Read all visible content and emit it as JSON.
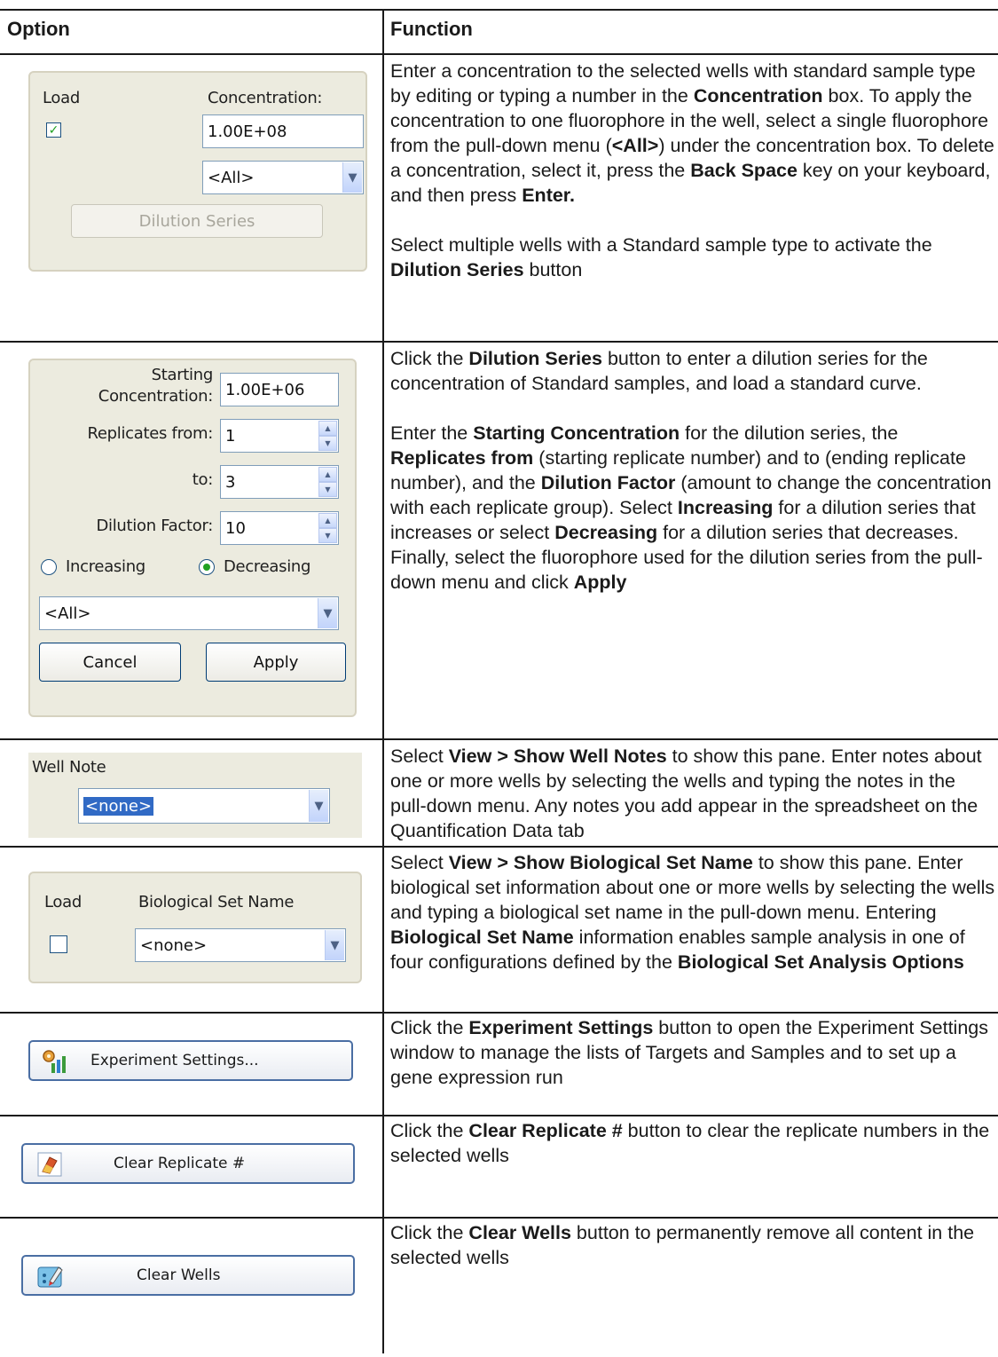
{
  "header": {
    "option": "Option",
    "function": "Function"
  },
  "widgets": {
    "concentration": {
      "load_label": "Load",
      "concentration_label": "Concentration:",
      "concentration_value": "1.00E+08",
      "fluor_select": "<All>",
      "dilution_button": "Dilution Series",
      "load_checked": true
    },
    "dilution": {
      "starting_label_1": "Starting",
      "starting_label_2": "Concentration:",
      "starting_value": "1.00E+06",
      "replicates_from_label": "Replicates from:",
      "replicates_from_value": "1",
      "to_label": "to:",
      "to_value": "3",
      "factor_label": "Dilution Factor:",
      "factor_value": "10",
      "increasing_label": "Increasing",
      "decreasing_label": "Decreasing",
      "fluor_select": "<All>",
      "cancel_button": "Cancel",
      "apply_button": "Apply"
    },
    "well_note": {
      "label": "Well Note",
      "value": "<none>"
    },
    "bio_set": {
      "load_label": "Load",
      "name_label": "Biological Set Name",
      "value": "<none>"
    },
    "experiment_settings": {
      "label": "Experiment Settings..."
    },
    "clear_replicate": {
      "label": "Clear Replicate #"
    },
    "clear_wells": {
      "label": "Clear Wells"
    }
  },
  "functions": {
    "r1_a": [
      "Enter a concentration to the selected wells with standard sample type by editing or typing a number in the ",
      "Concentration",
      " box. To apply the concentration to one fluorophore in the well, select a single fluorophore from the pull-down menu (",
      "<All>",
      ") under the concentration box. To delete a concentration, select it, press the ",
      "Back Space",
      " key on your keyboard, and then press ",
      "Enter."
    ],
    "r1_b": [
      "Select multiple wells with a Standard sample type to activate the ",
      "Dilution Series",
      " button"
    ],
    "r2_a": [
      "Click the ",
      "Dilution Series",
      " button to enter a dilution series for the concentration of Standard samples, and load a standard curve."
    ],
    "r2_b": [
      "Enter the ",
      "Starting Concentration",
      " for the dilution series, the ",
      "Replicates from",
      " (starting replicate number) and to (ending replicate number), and the ",
      "Dilution Factor",
      " (amount to change the concentration with each replicate group). Select ",
      "Increasing",
      " for a dilution series that increases or select ",
      "Decreasing",
      " for a dilution series that decreases. Finally, select the fluorophore used for the dilution series from the pull-down menu and click ",
      "Apply"
    ],
    "r3": [
      "Select ",
      "View > Show Well Notes",
      " to show this pane. Enter notes about one or more wells by selecting the wells and typing the notes in the pull-down menu. Any notes you add appear in the spreadsheet on the Quantification Data tab"
    ],
    "r4": [
      "Select ",
      "View > Show Biological Set Name",
      " to show this pane. Enter biological set information about one or more wells by selecting the wells and typing a biological set name in the pull-down menu. Entering ",
      "Biological Set Name",
      " information enables sample analysis in one of four configurations defined by the ",
      "Biological Set Analysis Options"
    ],
    "r5": [
      "Click the ",
      "Experiment Settings",
      " button to open the Experiment Settings window to manage the lists of Targets and Samples and to set up a gene expression run"
    ],
    "r6": [
      "Click the ",
      "Clear Replicate #",
      " button to clear the replicate numbers in the selected wells"
    ],
    "r7": [
      "Click the ",
      "Clear Wells",
      " button to permanently remove all content in the selected wells"
    ]
  },
  "colors": {
    "rule": "#1a1a1a",
    "panel": "#ecebdf",
    "check_green": "#21a121",
    "xp_border": "#003c74",
    "highlight": "#316ac5"
  }
}
